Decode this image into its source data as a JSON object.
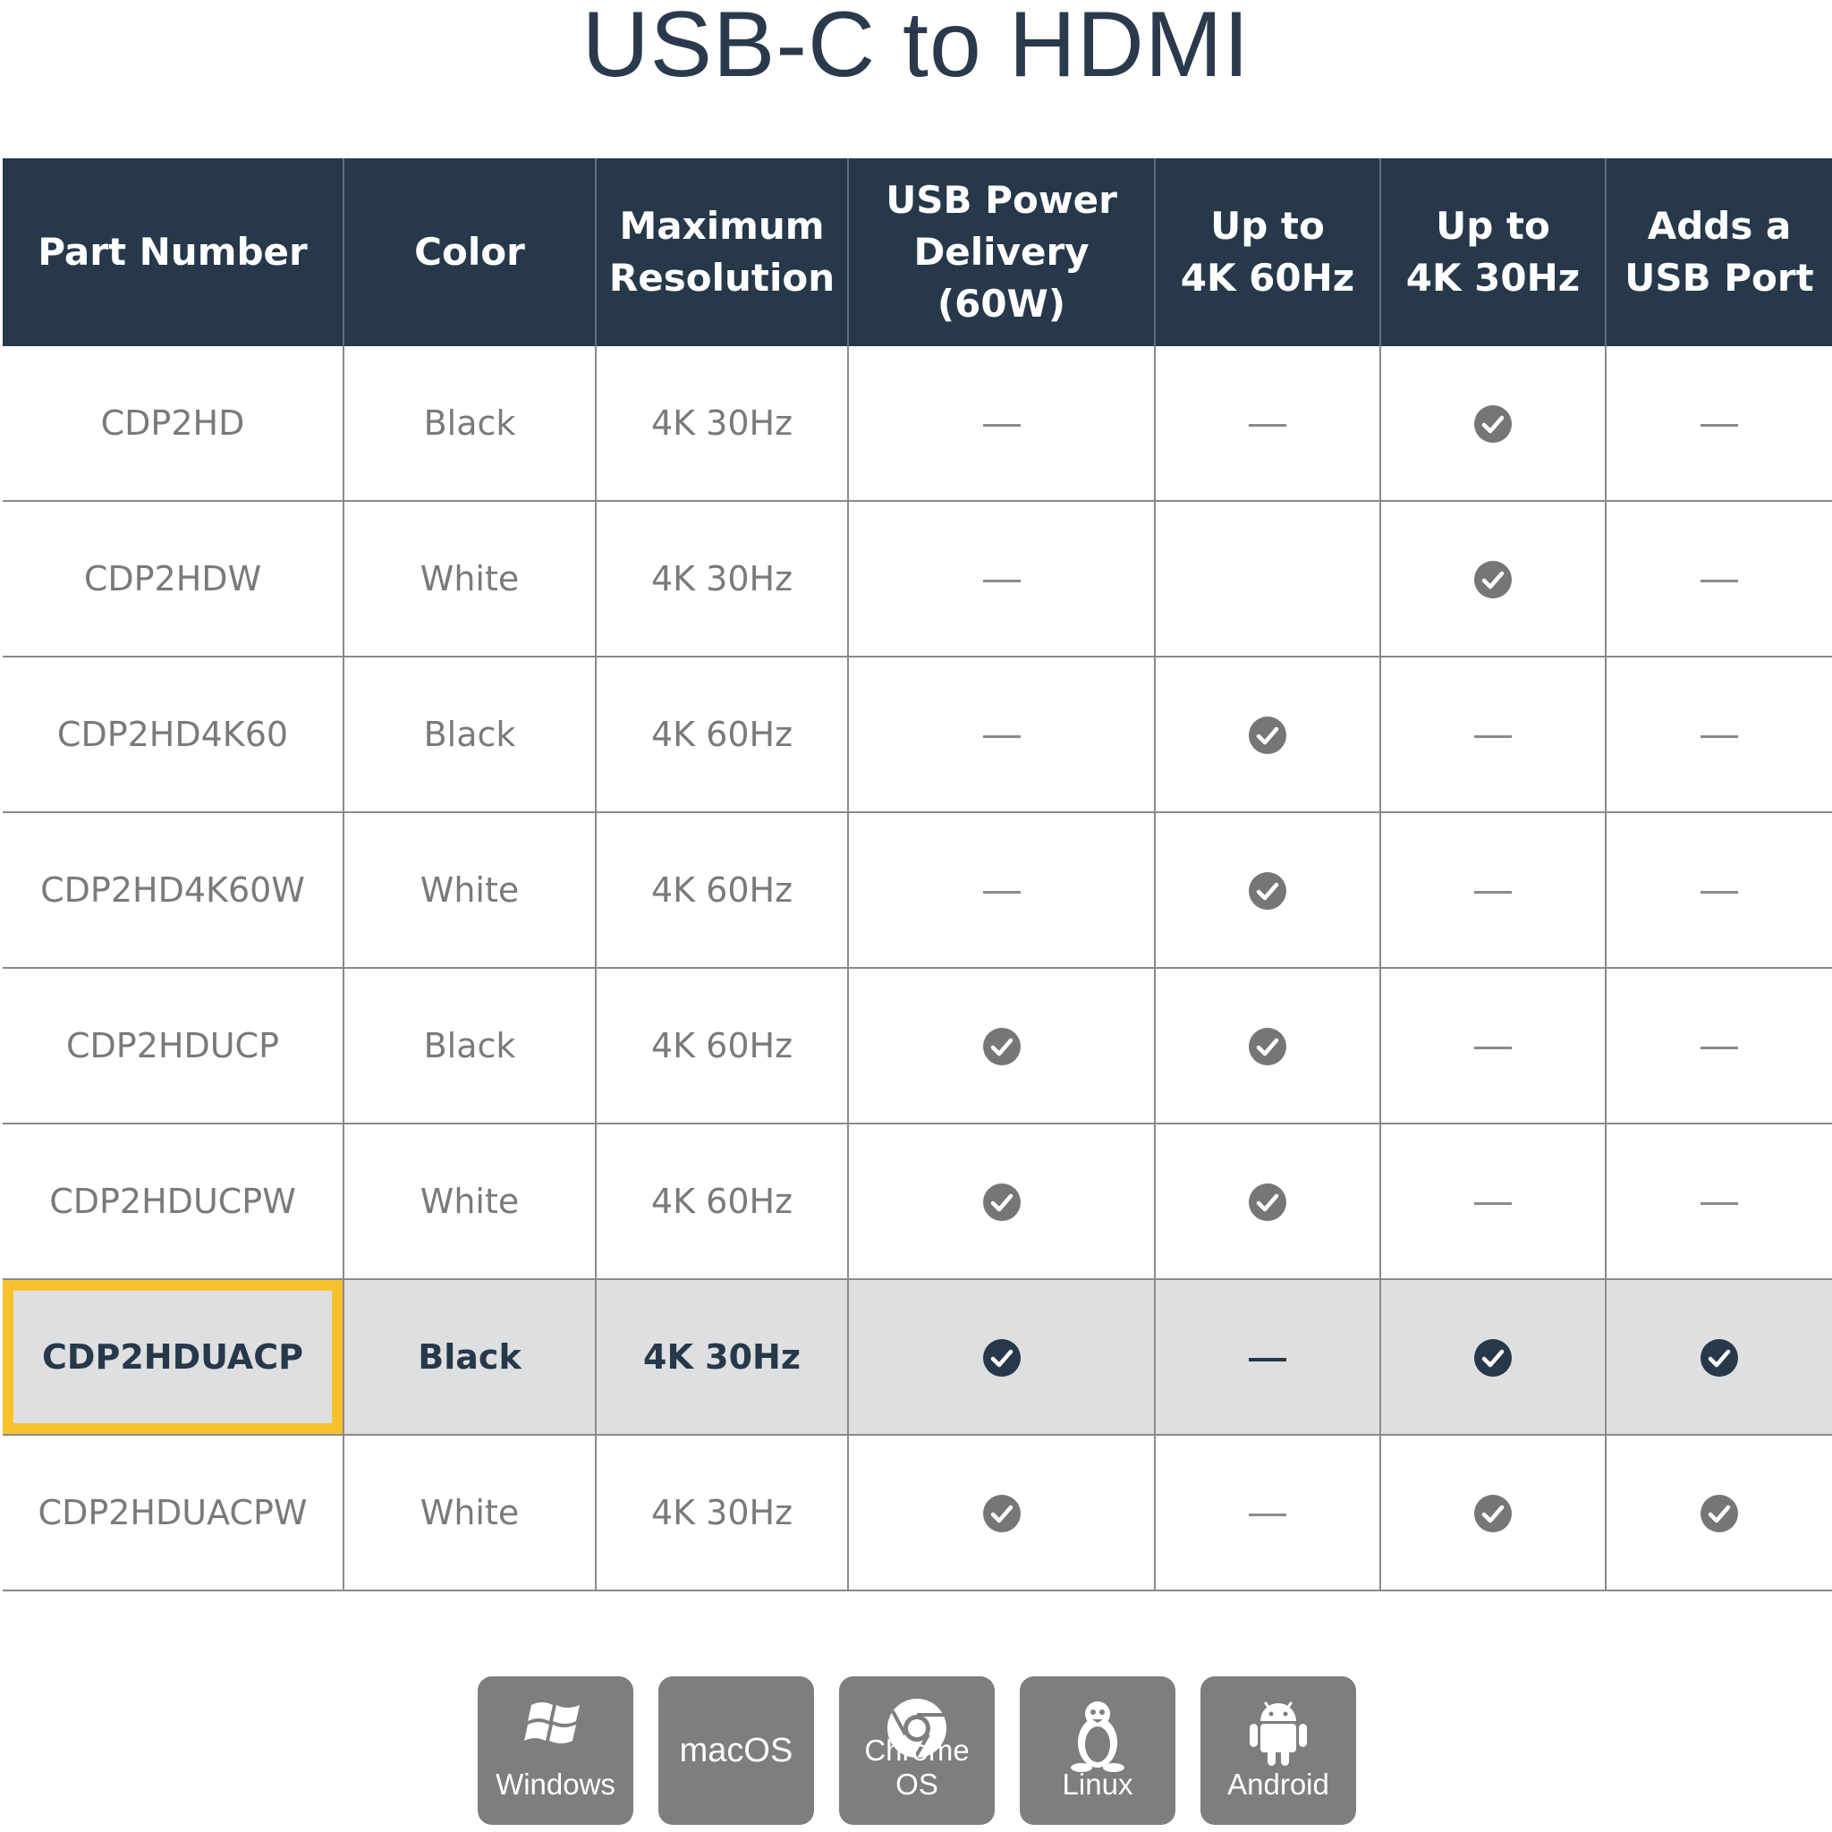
{
  "title": "USB-C to HDMI",
  "columns": [
    {
      "line1": "Part Number",
      "line2": ""
    },
    {
      "line1": "Color",
      "line2": ""
    },
    {
      "line1": "Maximum",
      "line2": "Resolution"
    },
    {
      "line1": "USB Power",
      "line2": "Delivery (60W)"
    },
    {
      "line1": "Up to",
      "line2": "4K 60Hz"
    },
    {
      "line1": "Up to",
      "line2": "4K 30Hz"
    },
    {
      "line1": "Adds a",
      "line2": "USB Port"
    }
  ],
  "rows": [
    {
      "part": "CDP2HD",
      "color": "Black",
      "resolution": "4K 30Hz",
      "pd": "no",
      "k60": "no",
      "k30": "yes",
      "usb": "no",
      "highlight": false
    },
    {
      "part": "CDP2HDW",
      "color": "White",
      "resolution": "4K 30Hz",
      "pd": "no",
      "k60": "none",
      "k30": "yes",
      "usb": "no",
      "highlight": false
    },
    {
      "part": "CDP2HD4K60",
      "color": "Black",
      "resolution": "4K 60Hz",
      "pd": "no",
      "k60": "yes",
      "k30": "no",
      "usb": "no",
      "highlight": false
    },
    {
      "part": "CDP2HD4K60W",
      "color": "White",
      "resolution": "4K 60Hz",
      "pd": "no",
      "k60": "yes",
      "k30": "no",
      "usb": "no",
      "highlight": false
    },
    {
      "part": "CDP2HDUCP",
      "color": "Black",
      "resolution": "4K 60Hz",
      "pd": "yes",
      "k60": "yes",
      "k30": "no",
      "usb": "no",
      "highlight": false
    },
    {
      "part": "CDP2HDUCPW",
      "color": "White",
      "resolution": "4K 60Hz",
      "pd": "yes",
      "k60": "yes",
      "k30": "no",
      "usb": "no",
      "highlight": false
    },
    {
      "part": "CDP2HDUACP",
      "color": "Black",
      "resolution": "4K 30Hz",
      "pd": "yes",
      "k60": "no",
      "k30": "yes",
      "usb": "yes",
      "highlight": true
    },
    {
      "part": "CDP2HDUACPW",
      "color": "White",
      "resolution": "4K 30Hz",
      "pd": "yes",
      "k60": "no",
      "k30": "yes",
      "usb": "yes",
      "highlight": false
    }
  ],
  "os_compat": [
    {
      "label": "Windows",
      "icon": "windows-icon"
    },
    {
      "label": "macOS",
      "icon": ""
    },
    {
      "label": "Chrome OS",
      "icon": "chrome-icon"
    },
    {
      "label": "Linux",
      "icon": "linux-tux-icon"
    },
    {
      "label": "Android",
      "icon": "android-icon"
    }
  ],
  "colors": {
    "header_bg": "#263849",
    "highlight_row_bg": "#dedfe1",
    "highlight_outline": "#f7c22e",
    "os_tile_bg": "#7d7e80"
  }
}
